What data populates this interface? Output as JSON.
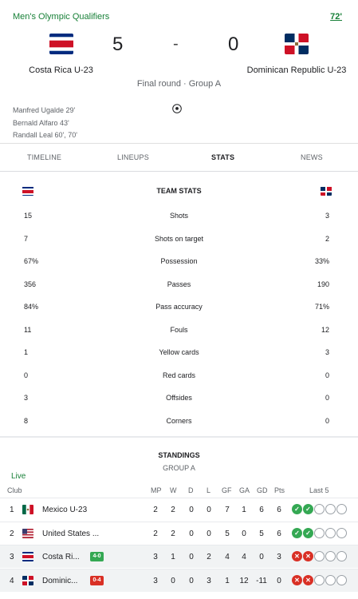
{
  "header": {
    "competition": "Men's Olympic Qualifiers",
    "minute": "72'"
  },
  "match": {
    "home": {
      "name": "Costa Rica U-23",
      "score": "5",
      "flag": "costa-rica"
    },
    "separator": "-",
    "away": {
      "name": "Dominican Republic U-23",
      "score": "0",
      "flag": "dominican-republic"
    },
    "stage": "Final round · Group A",
    "scorers": [
      "Manfred Ugalde 29'",
      "Bernald Alfaro 43'",
      "Randall Leal 60', 70'"
    ]
  },
  "tabs": [
    "TIMELINE",
    "LINEUPS",
    "STATS",
    "NEWS"
  ],
  "active_tab": "STATS",
  "team_stats": {
    "title": "TEAM STATS",
    "rows": [
      {
        "label": "Shots",
        "home": "15",
        "away": "3"
      },
      {
        "label": "Shots on target",
        "home": "7",
        "away": "2"
      },
      {
        "label": "Possession",
        "home": "67%",
        "away": "33%"
      },
      {
        "label": "Passes",
        "home": "356",
        "away": "190"
      },
      {
        "label": "Pass accuracy",
        "home": "84%",
        "away": "71%"
      },
      {
        "label": "Fouls",
        "home": "11",
        "away": "12"
      },
      {
        "label": "Yellow cards",
        "home": "1",
        "away": "3"
      },
      {
        "label": "Red cards",
        "home": "0",
        "away": "0"
      },
      {
        "label": "Offsides",
        "home": "3",
        "away": "0"
      },
      {
        "label": "Corners",
        "home": "8",
        "away": "0"
      }
    ]
  },
  "standings": {
    "title": "STANDINGS",
    "group": "GROUP A",
    "live_label": "Live",
    "columns": {
      "club": "Club",
      "mp": "MP",
      "w": "W",
      "d": "D",
      "l": "L",
      "gf": "GF",
      "ga": "GA",
      "gd": "GD",
      "pts": "Pts",
      "last5": "Last 5"
    },
    "rows": [
      {
        "pos": "1",
        "club": "Mexico U-23",
        "flag": "mexico",
        "badge": "",
        "badge_color": "",
        "mp": "2",
        "w": "2",
        "d": "0",
        "l": "0",
        "gf": "7",
        "ga": "1",
        "gd": "6",
        "pts": "6",
        "last5": [
          "W",
          "W",
          "N",
          "N",
          "N"
        ],
        "highlight": false
      },
      {
        "pos": "2",
        "club": "United States ...",
        "flag": "usa",
        "badge": "",
        "badge_color": "",
        "mp": "2",
        "w": "2",
        "d": "0",
        "l": "0",
        "gf": "5",
        "ga": "0",
        "gd": "5",
        "pts": "6",
        "last5": [
          "W",
          "W",
          "N",
          "N",
          "N"
        ],
        "highlight": false
      },
      {
        "pos": "3",
        "club": "Costa Ri...",
        "flag": "costa-rica",
        "badge": "4-0",
        "badge_color": "#34a853",
        "mp": "3",
        "w": "1",
        "d": "0",
        "l": "2",
        "gf": "4",
        "ga": "4",
        "gd": "0",
        "pts": "3",
        "last5": [
          "L",
          "L",
          "N",
          "N",
          "N"
        ],
        "highlight": true
      },
      {
        "pos": "4",
        "club": "Dominic...",
        "flag": "dominican-republic",
        "badge": "0-4",
        "badge_color": "#d93025",
        "mp": "3",
        "w": "0",
        "d": "0",
        "l": "3",
        "gf": "1",
        "ga": "12",
        "gd": "-11",
        "pts": "0",
        "last5": [
          "L",
          "L",
          "N",
          "N",
          "N"
        ],
        "highlight": true
      }
    ]
  },
  "colors": {
    "accent_green": "#188038",
    "win": "#34a853",
    "loss": "#d93025"
  }
}
